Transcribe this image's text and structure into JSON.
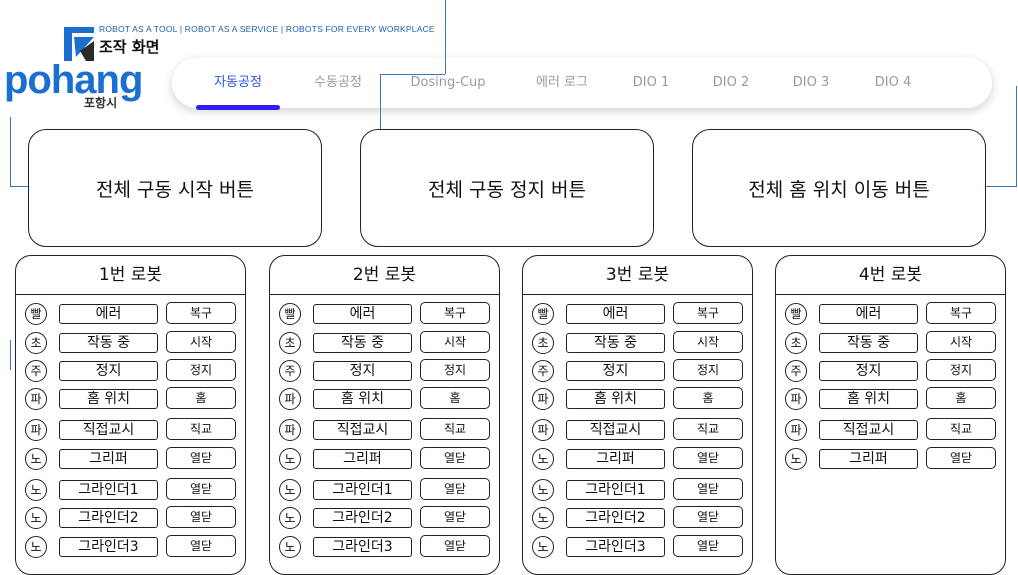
{
  "header": {
    "tagline": "ROBOT AS A TOOL | ROBOT AS A SERVICE | ROBOTS FOR EVERY WORKPLACE",
    "screen_title": "조작 화면",
    "brand_word": "pohang",
    "brand_city": "포항시"
  },
  "nav": {
    "tabs": [
      "자동공정",
      "수동공정",
      "Dosing-Cup",
      "에러 로그",
      "DIO 1",
      "DIO 2",
      "DIO 3",
      "DIO 4"
    ],
    "active_tab": "자동공정",
    "active_color": "#2f53e0"
  },
  "global_buttons": {
    "start_all": "전체 구동 시작 버튼",
    "stop_all": "전체 구동 정지 버튼",
    "home_all": "전체 홈 위치 이동 버튼"
  },
  "robots": [
    {
      "title": "1번 로봇",
      "rows": [
        {
          "lamp": "빨",
          "status": "에러",
          "button": "복구"
        },
        {
          "lamp": "초",
          "status": "작동 중",
          "button": "시작"
        },
        {
          "lamp": "주",
          "status": "정지",
          "button": "정지"
        },
        {
          "lamp": "파",
          "status": "홈 위치",
          "button": "홈"
        },
        {
          "lamp": "파",
          "status": "직접교시",
          "button": "직교"
        },
        {
          "lamp": "노",
          "status": "그리퍼",
          "button": "열닫"
        },
        {
          "lamp": "노",
          "status": "그라인더1",
          "button": "열닫"
        },
        {
          "lamp": "노",
          "status": "그라인더2",
          "button": "열닫"
        },
        {
          "lamp": "노",
          "status": "그라인더3",
          "button": "열닫"
        }
      ]
    },
    {
      "title": "2번 로봇",
      "rows": [
        {
          "lamp": "빨",
          "status": "에러",
          "button": "복구"
        },
        {
          "lamp": "초",
          "status": "작동 중",
          "button": "시작"
        },
        {
          "lamp": "주",
          "status": "정지",
          "button": "정지"
        },
        {
          "lamp": "파",
          "status": "홈 위치",
          "button": "홈"
        },
        {
          "lamp": "파",
          "status": "직접교시",
          "button": "직교"
        },
        {
          "lamp": "노",
          "status": "그리퍼",
          "button": "열닫"
        },
        {
          "lamp": "노",
          "status": "그라인더1",
          "button": "열닫"
        },
        {
          "lamp": "노",
          "status": "그라인더2",
          "button": "열닫"
        },
        {
          "lamp": "노",
          "status": "그라인더3",
          "button": "열닫"
        }
      ]
    },
    {
      "title": "3번 로봇",
      "rows": [
        {
          "lamp": "빨",
          "status": "에러",
          "button": "복구"
        },
        {
          "lamp": "초",
          "status": "작동 중",
          "button": "시작"
        },
        {
          "lamp": "주",
          "status": "정지",
          "button": "정지"
        },
        {
          "lamp": "파",
          "status": "홈 위치",
          "button": "홈"
        },
        {
          "lamp": "파",
          "status": "직접교시",
          "button": "직교"
        },
        {
          "lamp": "노",
          "status": "그리퍼",
          "button": "열닫"
        },
        {
          "lamp": "노",
          "status": "그라인더1",
          "button": "열닫"
        },
        {
          "lamp": "노",
          "status": "그라인더2",
          "button": "열닫"
        },
        {
          "lamp": "노",
          "status": "그라인더3",
          "button": "열닫"
        }
      ]
    },
    {
      "title": "4번 로봇",
      "rows": [
        {
          "lamp": "빨",
          "status": "에러",
          "button": "복구"
        },
        {
          "lamp": "초",
          "status": "작동 중",
          "button": "시작"
        },
        {
          "lamp": "주",
          "status": "정지",
          "button": "정지"
        },
        {
          "lamp": "파",
          "status": "홈 위치",
          "button": "홈"
        },
        {
          "lamp": "파",
          "status": "직접교시",
          "button": "직교"
        },
        {
          "lamp": "노",
          "status": "그리퍼",
          "button": "열닫"
        }
      ]
    }
  ]
}
